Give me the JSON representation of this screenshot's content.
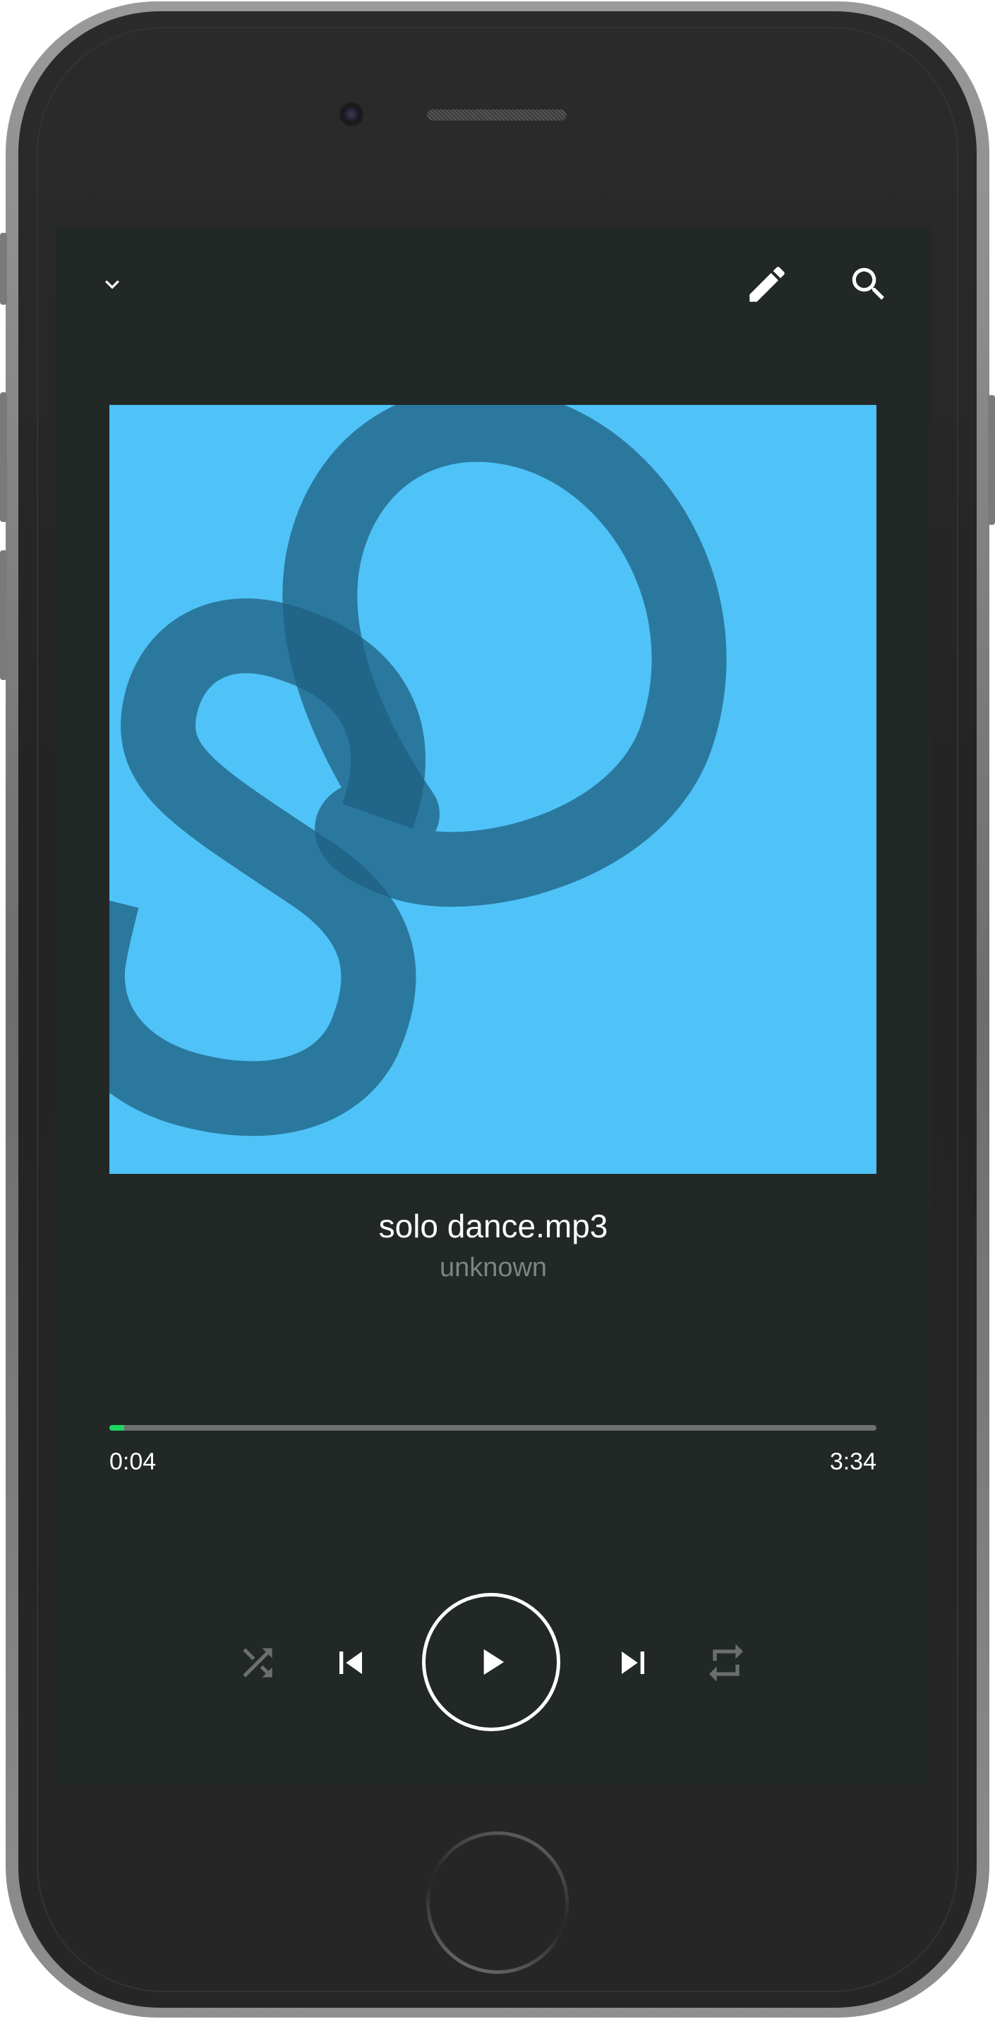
{
  "app": {
    "header": {
      "collapse_icon": "chevron-down-icon",
      "edit_icon": "pencil-icon",
      "search_icon": "search-icon"
    },
    "album_art": {
      "letters": "SO",
      "background_color": "#4fc3f7",
      "stroke_color": "#2a6d92"
    },
    "track": {
      "title": "solo dance.mp3",
      "artist": "unknown"
    },
    "playback": {
      "elapsed": "0:04",
      "duration": "3:34",
      "progress_fraction": 0.019,
      "progress_color": "#1ed760"
    },
    "controls": {
      "shuffle_icon": "shuffle-icon",
      "previous_icon": "skip-previous-icon",
      "play_icon": "play-icon",
      "next_icon": "skip-next-icon",
      "repeat_icon": "repeat-icon"
    },
    "colors": {
      "screen_background": "#212826",
      "primary_text": "#ffffff",
      "secondary_text": "#7d8482",
      "disabled_icon": "#6b6f6e"
    }
  }
}
